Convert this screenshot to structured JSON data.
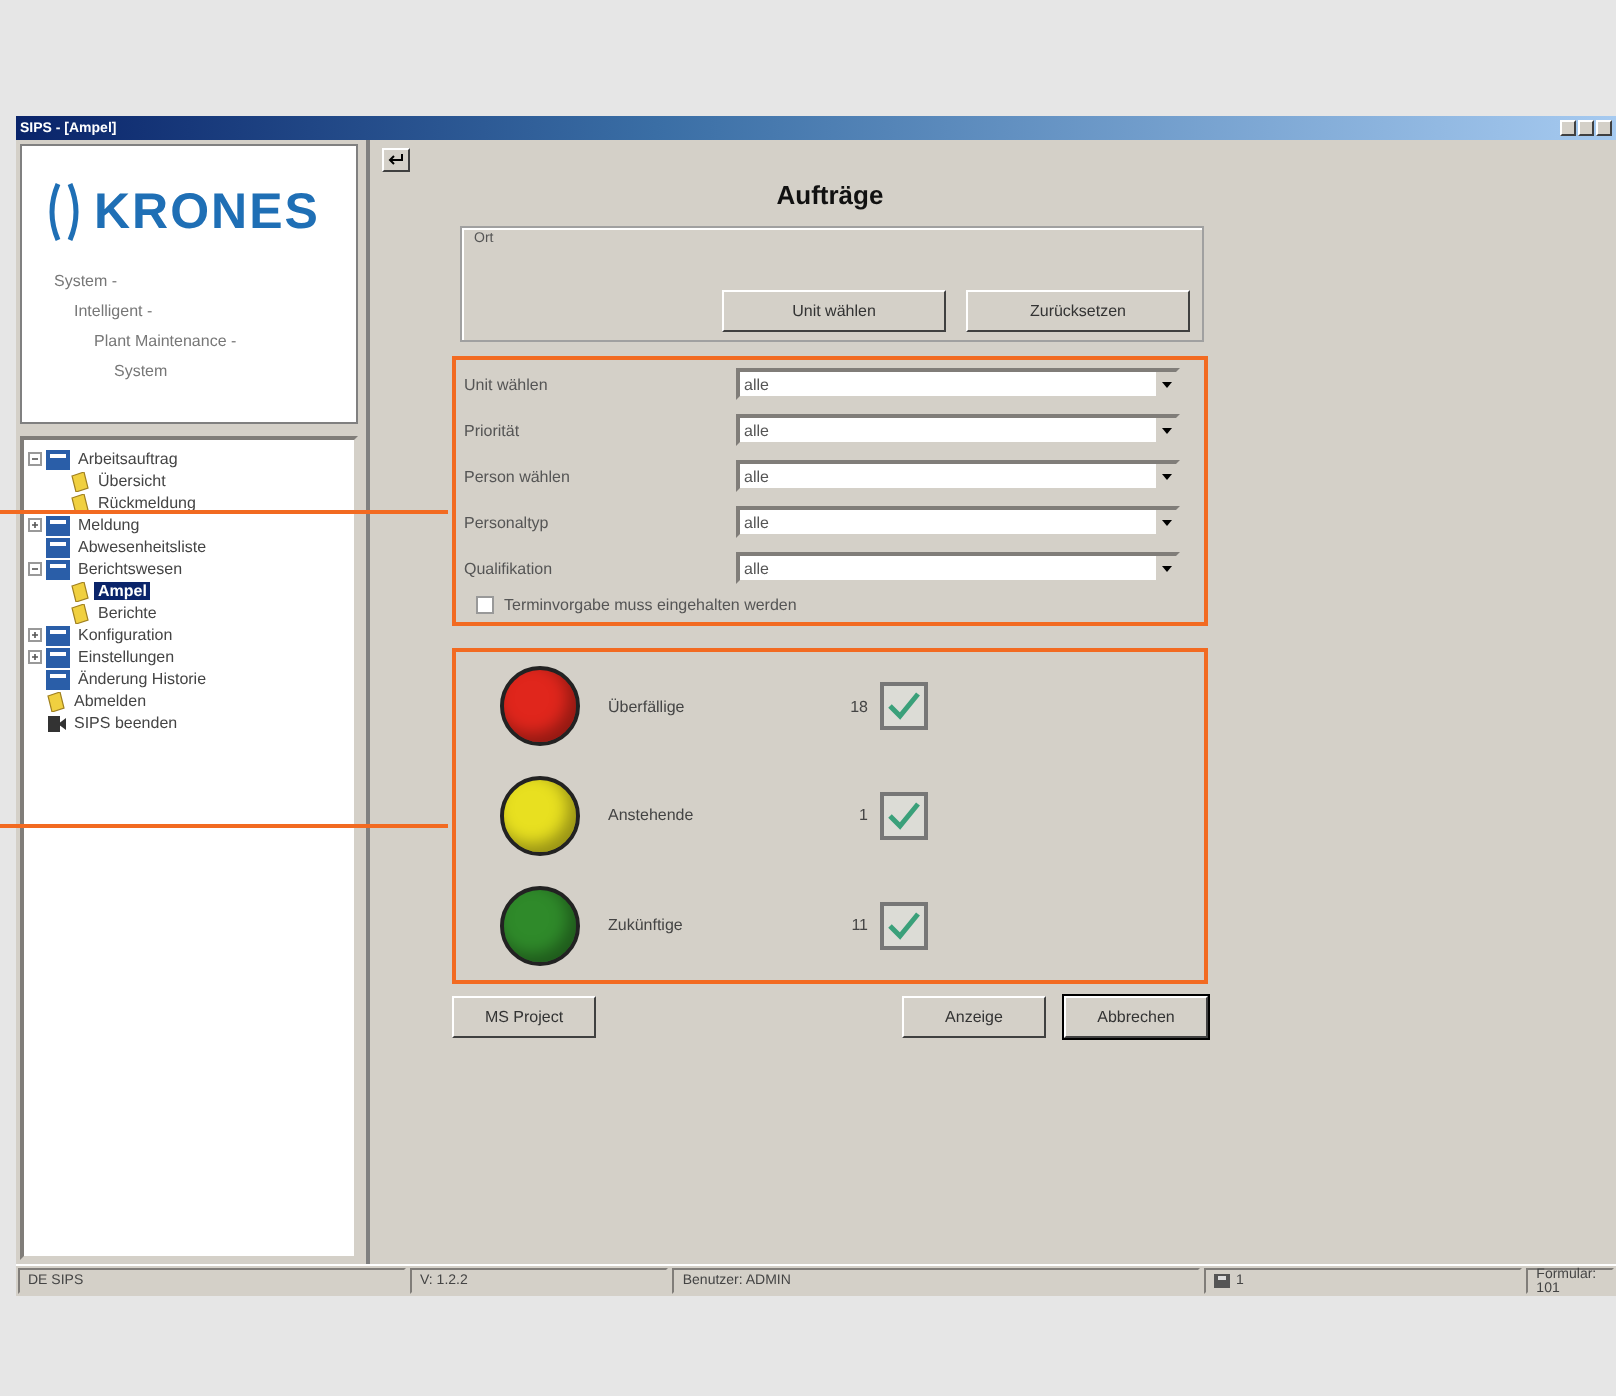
{
  "window": {
    "title": "SIPS - [Ampel]"
  },
  "logo": {
    "name": "KRONES",
    "tagline": [
      "System -",
      "Intelligent -",
      "Plant Maintenance -",
      "System"
    ]
  },
  "tree": [
    {
      "label": "Arbeitsauftrag",
      "kind": "book",
      "expanded": true,
      "selected": false,
      "children": [
        {
          "label": "Übersicht",
          "kind": "page",
          "selected": false
        },
        {
          "label": "Rückmeldung",
          "kind": "page",
          "selected": false
        }
      ]
    },
    {
      "label": "Meldung",
      "kind": "book",
      "expanded": false,
      "selected": false
    },
    {
      "label": "Abwesenheitsliste",
      "kind": "book",
      "selected": false
    },
    {
      "label": "Berichtswesen",
      "kind": "book",
      "expanded": true,
      "selected": false,
      "children": [
        {
          "label": "Ampel",
          "kind": "page",
          "selected": true
        },
        {
          "label": "Berichte",
          "kind": "page",
          "selected": false
        }
      ]
    },
    {
      "label": "Konfiguration",
      "kind": "book",
      "expanded": false,
      "selected": false
    },
    {
      "label": "Einstellungen",
      "kind": "book",
      "expanded": false,
      "selected": false
    },
    {
      "label": "Änderung Historie",
      "kind": "book",
      "selected": false
    },
    {
      "label": "Abmelden",
      "kind": "page",
      "selected": false
    },
    {
      "label": "SIPS beenden",
      "kind": "exit",
      "selected": false
    }
  ],
  "form": {
    "title": "Aufträge",
    "group": {
      "label": "Ort",
      "buttons": [
        "Unit wählen",
        "Zurücksetzen"
      ]
    },
    "filters": [
      {
        "label": "Unit wählen",
        "value": "alle"
      },
      {
        "label": "Priorität",
        "value": "alle"
      },
      {
        "label": "Person wählen",
        "value": "alle"
      },
      {
        "label": "Personaltyp",
        "value": "alle"
      },
      {
        "label": "Qualifikation",
        "value": "alle"
      }
    ],
    "deadline": {
      "label": "Terminvorgabe muss eingehalten werden",
      "checked": false
    },
    "lights": [
      {
        "label": "Überfällige",
        "count": "18",
        "color": "#e0261c",
        "checked": true
      },
      {
        "label": "Anstehende",
        "count": "1",
        "color": "#e8e020",
        "checked": true
      },
      {
        "label": "Zukünftige",
        "count": "11",
        "color": "#2f8a2a",
        "checked": true
      }
    ],
    "buttons": {
      "left": "MS Project",
      "right": [
        "Anzeige",
        "Abbrechen"
      ]
    }
  },
  "status_bar": [
    "DE SIPS",
    "V: 1.2.2",
    "Benutzer: ADMIN",
    "1",
    "Formular: 101"
  ]
}
